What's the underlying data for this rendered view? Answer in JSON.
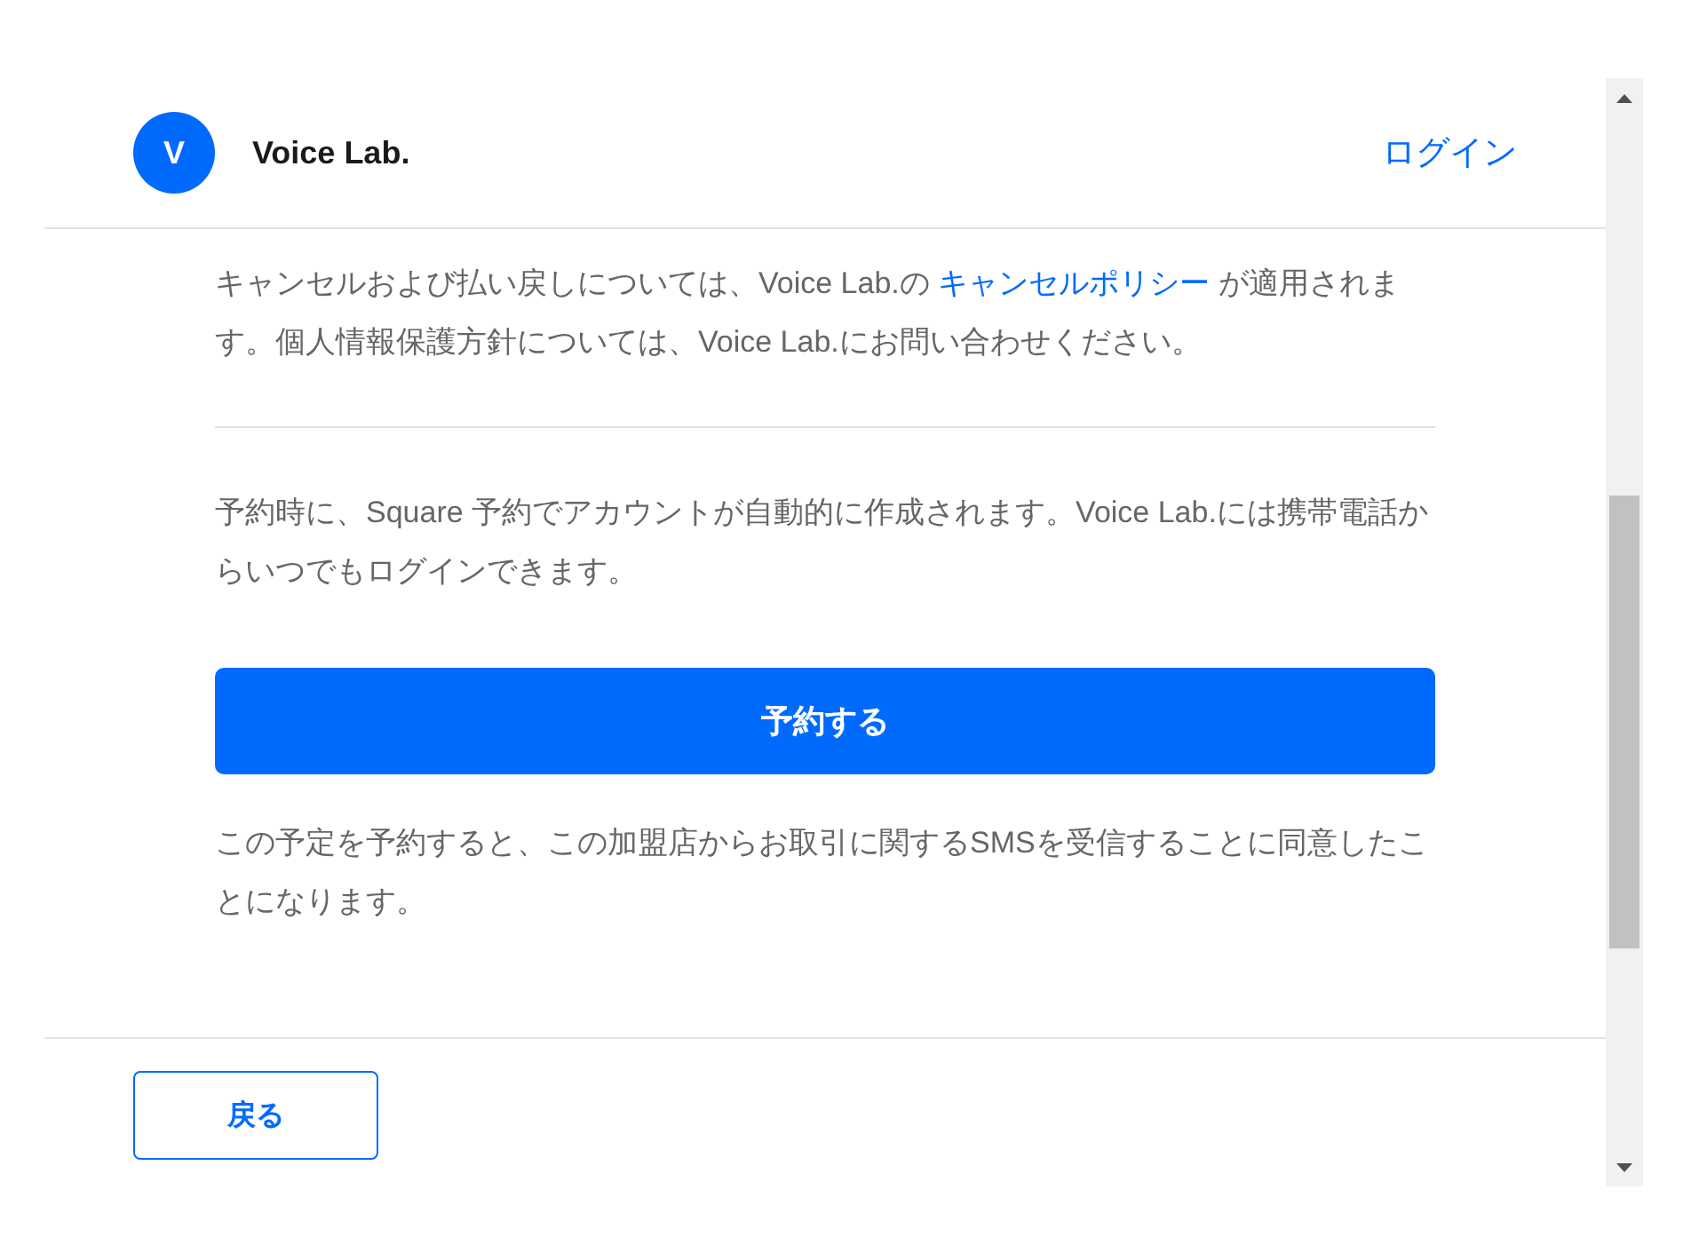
{
  "header": {
    "avatar_letter": "V",
    "business_name": "Voice Lab.",
    "login_link": "ログイン"
  },
  "policy": {
    "before": "キャンセルおよび払い戻しについては、Voice Lab.の ",
    "link": "キャンセルポリシー",
    "after": " が適用されます。個人情報保護方針については、Voice Lab.にお問い合わせください。"
  },
  "account_note": "予約時に、Square 予約でアカウントが自動的に作成されます。Voice Lab.には携帯電話からいつでもログインできます。",
  "book_button": "予約する",
  "sms_note": "この予定を予約すると、この加盟店からお取引に関するSMSを受信することに同意したことになります。",
  "back_button": "戻る"
}
